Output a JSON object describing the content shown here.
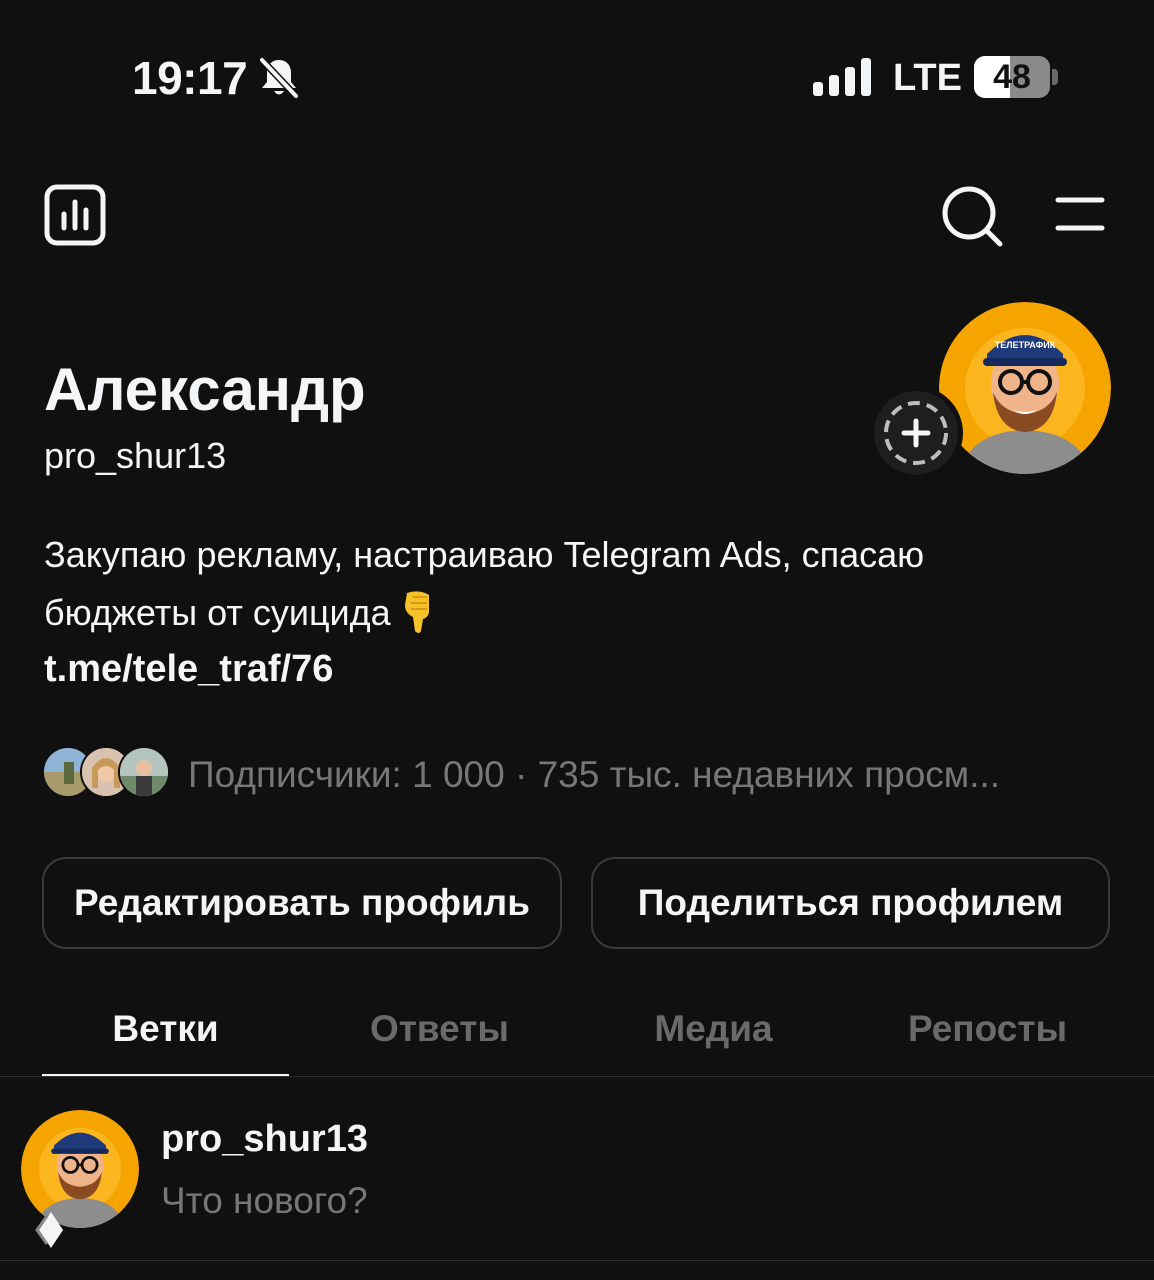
{
  "status_bar": {
    "time": "19:17",
    "network": "LTE",
    "battery": "48",
    "battery_level": 0.48,
    "icons": [
      "bell-off-icon",
      "signal-icon",
      "battery-icon"
    ]
  },
  "top_bar": {
    "icons": [
      "insights-icon",
      "search-icon",
      "menu-icon"
    ]
  },
  "profile": {
    "name": "Александр",
    "username": "pro_shur13",
    "bio_line1": "Закупаю рекламу, настраиваю Telegram Ads, спасаю",
    "bio_line2": "бюджеты от суицида",
    "bio_emoji": "backhand-index-pointing-down-emoji",
    "link": "t.me/tele_traf/76",
    "followers_text": "Подписчики: 1 000 · 735 тыс. недавних просм...",
    "accent_avatar_bg": "#f6a400"
  },
  "buttons": {
    "edit": "Редактировать профиль",
    "share": "Поделиться профилем"
  },
  "tabs": [
    {
      "label": "Ветки",
      "active": true
    },
    {
      "label": "Ответы",
      "active": false
    },
    {
      "label": "Медиа",
      "active": false
    },
    {
      "label": "Репосты",
      "active": false
    }
  ],
  "composer": {
    "username": "pro_shur13",
    "placeholder": "Что нового?"
  }
}
